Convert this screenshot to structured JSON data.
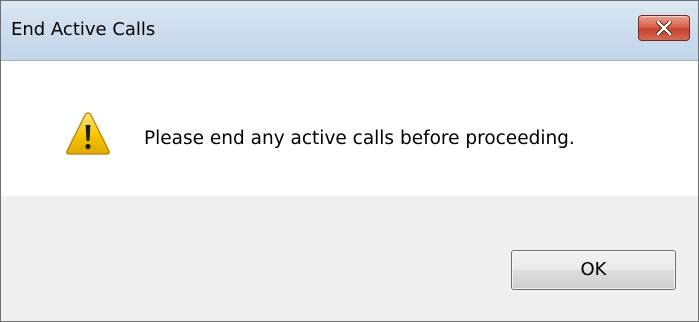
{
  "dialog": {
    "title": "End Active Calls",
    "message": "Please end any active calls before proceeding.",
    "ok_label": "OK",
    "close_icon": "close-icon",
    "warning_icon": "warning-icon"
  },
  "colors": {
    "titlebar": "#cfdeee",
    "close_button": "#d9614c",
    "warning_yellow": "#f5c400",
    "content_bg": "#ffffff",
    "footer_bg": "#f0f0f0"
  }
}
